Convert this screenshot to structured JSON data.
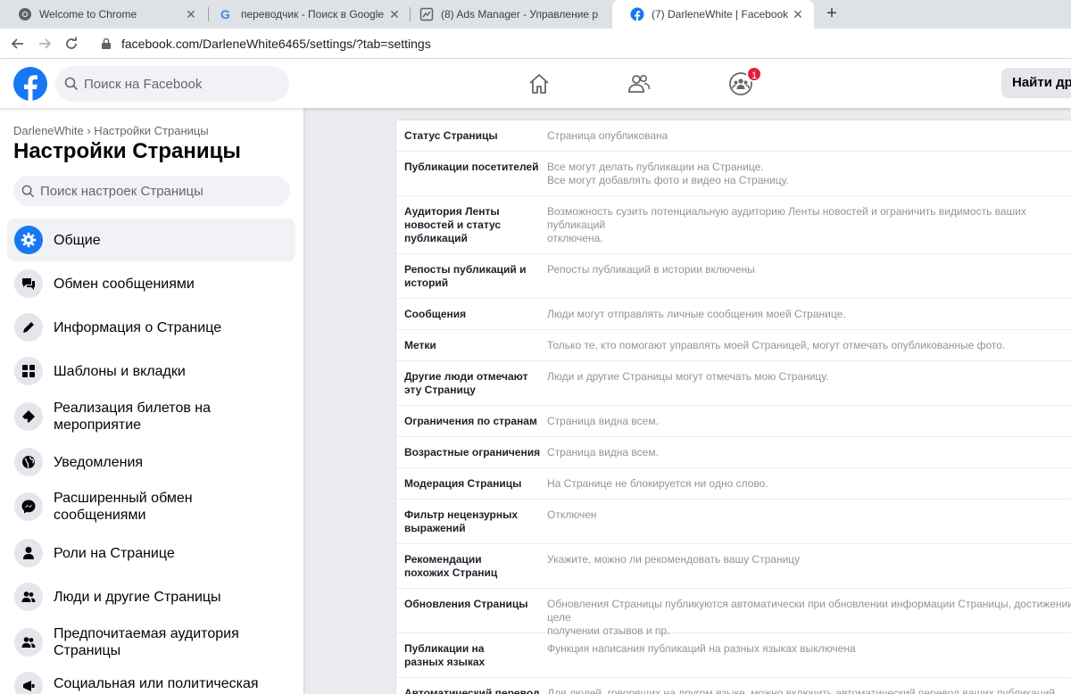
{
  "browser": {
    "tabs": [
      {
        "title": "Welcome to Chrome",
        "icon": "chrome-icon"
      },
      {
        "title": "переводчик - Поиск в Google",
        "icon": "google-icon"
      },
      {
        "title": "(8) Ads Manager - Управление р",
        "icon": "ads-manager-icon"
      },
      {
        "title": "(7) DarleneWhite | Facebook",
        "icon": "facebook-icon",
        "active": true
      }
    ],
    "url": "facebook.com/DarleneWhite6465/settings/?tab=settings"
  },
  "header": {
    "search_placeholder": "Поиск на Facebook",
    "groups_badge": "1",
    "find_friends_label": "Найти дру"
  },
  "sidebar": {
    "breadcrumb": "DarleneWhite › Настройки Страницы",
    "title": "Настройки Страницы",
    "search_placeholder": "Поиск настроек Страницы",
    "items": [
      {
        "label": "Общие",
        "icon": "gear-icon",
        "active": true
      },
      {
        "label": "Обмен сообщениями",
        "icon": "chat-icon"
      },
      {
        "label": "Информация о Странице",
        "icon": "pencil-icon"
      },
      {
        "label": "Шаблоны и вкладки",
        "icon": "grid-icon"
      },
      {
        "label": "Реализация билетов на мероприятие",
        "icon": "ticket-icon"
      },
      {
        "label": "Уведомления",
        "icon": "globe-icon"
      },
      {
        "label": "Расширенный обмен сообщениями",
        "icon": "messenger-icon"
      },
      {
        "label": "Роли на Странице",
        "icon": "person-icon"
      },
      {
        "label": "Люди и другие Страницы",
        "icon": "people-icon"
      },
      {
        "label": "Предпочитаемая аудитория Страницы",
        "icon": "audience-icon"
      },
      {
        "label": "Социальная или политическая",
        "icon": "megaphone-icon"
      }
    ]
  },
  "settings": [
    {
      "name": "Статус Страницы",
      "value": "Страница опубликована"
    },
    {
      "name": "Публикации посетителей",
      "value": "Все могут делать публикации на Странице.\nВсе могут добавлять фото и видео на Страницу."
    },
    {
      "name": "Аудитория Ленты новостей и статус публикаций",
      "value": "Возможность сузить потенциальную аудиторию Ленты новостей и ограничить видимость ваших публикаций\nотключена."
    },
    {
      "name": "Репосты публикаций и историй",
      "value": "Репосты публикаций в истории включены"
    },
    {
      "name": "Сообщения",
      "value": "Люди могут отправлять личные сообщения моей Странице."
    },
    {
      "name": "Метки",
      "value": "Только те, кто помогают управлять моей Страницей, могут отмечать опубликованные фото."
    },
    {
      "name": "Другие люди отмечают эту Страницу",
      "value": "Люди и другие Страницы могут отмечать мою Страницу."
    },
    {
      "name": "Ограничения по странам",
      "value": "Страница видна всем."
    },
    {
      "name": "Возрастные ограничения",
      "value": "Страница видна всем."
    },
    {
      "name": "Модерация Страницы",
      "value": "На Странице не блокируется ни одно слово."
    },
    {
      "name": "Фильтр нецензурных выражений",
      "value": "Отключен"
    },
    {
      "name": "Рекомендации похожих Страниц",
      "value": "Укажите, можно ли рекомендовать вашу Страницу"
    },
    {
      "name": "Обновления Страницы",
      "value": "Обновления Страницы публикуются автоматически при обновлении информации Страницы, достижении целе\nполучении отзывов и пр."
    },
    {
      "name": "Публикации на разных языках",
      "value": "Функция написания публикаций на разных языках выключена"
    },
    {
      "name": "Автоматический перевод",
      "value": "Для людей, говорящих на другом языке, можно включить автоматический перевод ваших публикаций"
    }
  ]
}
